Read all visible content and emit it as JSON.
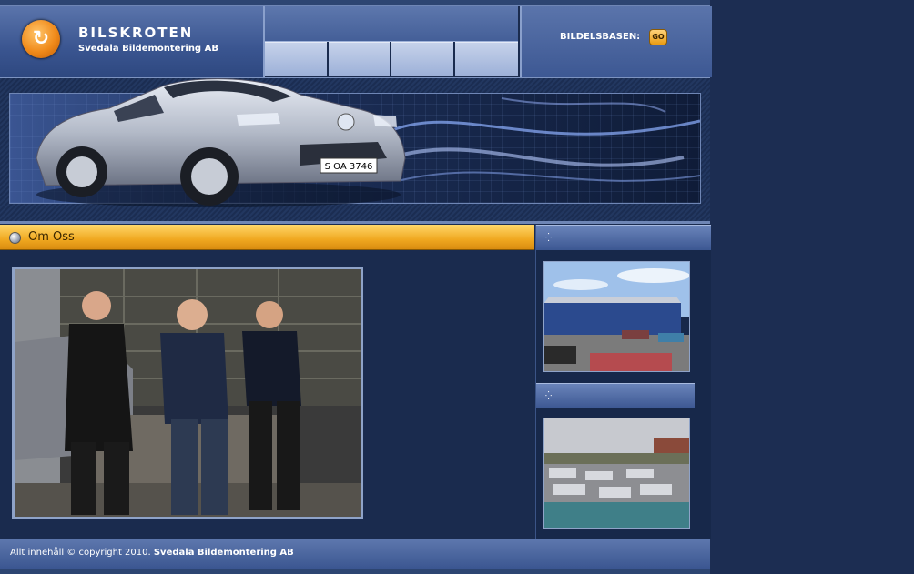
{
  "header": {
    "brand_title": "BILSKROTEN",
    "brand_subtitle": "Svedala Bildemontering AB",
    "logo_icon": "recycle-arrow-icon",
    "nav_tabs": [
      "",
      "",
      "",
      ""
    ],
    "database_label": "BILDELSBASEN:",
    "go_label": "GO"
  },
  "banner": {
    "car_plate": "S OA 3746"
  },
  "main": {
    "section_title": "Om Oss"
  },
  "sidebar": {
    "heading_1": "",
    "heading_2": ""
  },
  "footer": {
    "copyright_prefix": "Allt innehåll © copyright 2010.",
    "company": "Svedala Bildemontering AB"
  },
  "colors": {
    "accent_orange": "#f0a820",
    "header_blue": "#3a5590",
    "page_background": "#1c2d52"
  }
}
